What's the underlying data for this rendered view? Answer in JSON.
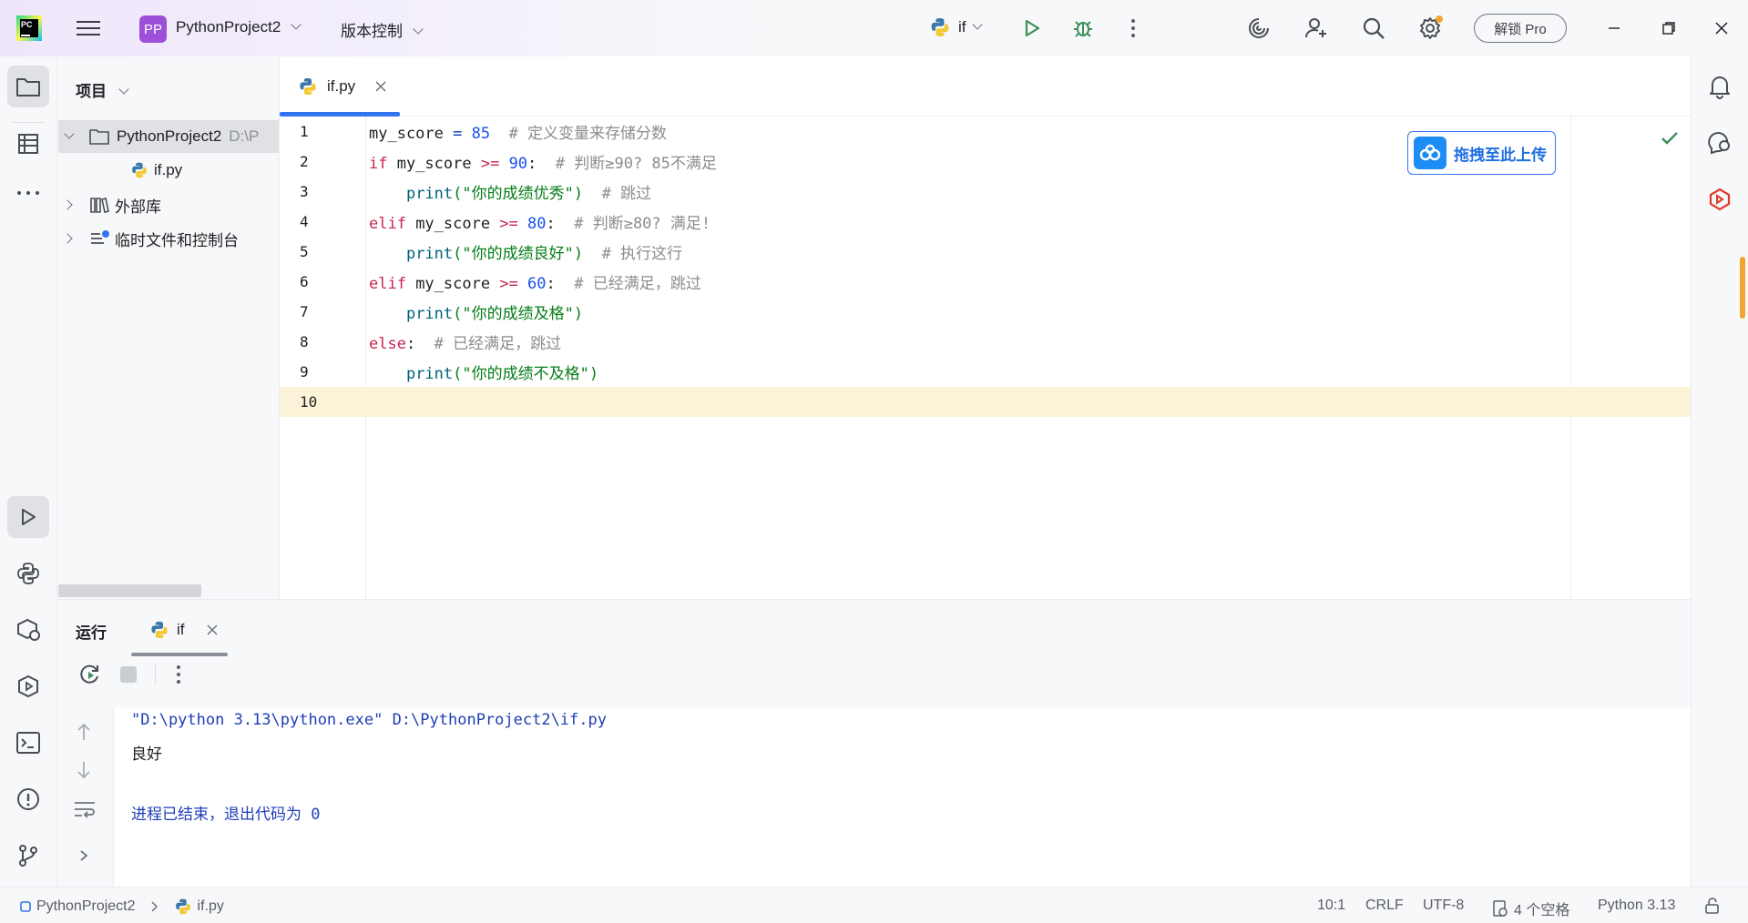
{
  "titlebar": {
    "project_badge": "PP",
    "project_name": "PythonProject2",
    "vcs_label": "版本控制",
    "run_config": "if",
    "pro_button": "解锁 Pro"
  },
  "project_panel": {
    "title": "项目",
    "tree": [
      {
        "label": "PythonProject2",
        "suffix": "D:\\P",
        "type": "folder",
        "expanded": true
      },
      {
        "label": "if.py",
        "type": "python-file"
      },
      {
        "label": "外部库",
        "type": "library"
      },
      {
        "label": "临时文件和控制台",
        "type": "scratches"
      }
    ]
  },
  "editor": {
    "tab_label": "if.py",
    "line_numbers": [
      "1",
      "2",
      "3",
      "4",
      "5",
      "6",
      "7",
      "8",
      "9",
      "10"
    ],
    "code": {
      "l1": [
        "my_score",
        " = ",
        "85",
        "  # 定义变量来存储分数"
      ],
      "l2": [
        "if",
        " my_score ",
        ">=",
        " 90",
        ":",
        "  # 判断≥90? 85不满足"
      ],
      "l3": [
        "    ",
        "print",
        "(\"你的成绩优秀\")",
        "  # 跳过"
      ],
      "l4": [
        "elif",
        " my_score ",
        ">=",
        " 80",
        ":",
        "  # 判断≥80? 满足!"
      ],
      "l5": [
        "    ",
        "print",
        "(\"你的成绩良好\")",
        "  # 执行这行"
      ],
      "l6": [
        "elif",
        " my_score ",
        ">=",
        " 60",
        ":",
        "  # 已经满足，跳过"
      ],
      "l7": [
        "    ",
        "print",
        "(\"你的成绩及格\")"
      ],
      "l8": [
        "else",
        ":",
        "  # 已经满足，跳过"
      ],
      "l9": [
        "    ",
        "print",
        "(\"你的成绩不及格\")"
      ]
    },
    "upload_button": "拖拽至此上传"
  },
  "run_panel": {
    "title": "运行",
    "tab_label": "if",
    "console": [
      "\"D:\\python 3.13\\python.exe\" D:\\PythonProject2\\if.py",
      "良好",
      "",
      "进程已结束，退出代码为 0"
    ]
  },
  "statusbar": {
    "breadcrumb_project": "PythonProject2",
    "breadcrumb_file": "if.py",
    "cursor": "10:1",
    "line_ending": "CRLF",
    "encoding": "UTF-8",
    "indent": "4 个空格",
    "interpreter": "Python 3.13"
  },
  "icons": [
    "pycharm-logo",
    "hamburger-icon",
    "chevron-down-icon",
    "python-icon",
    "run-icon",
    "debug-icon",
    "more-icon",
    "ai-spiral-icon",
    "add-user-icon",
    "search-icon",
    "settings-icon",
    "minimize-icon",
    "restore-icon",
    "close-icon",
    "folder-icon",
    "structure-icon",
    "play-icon",
    "python-console-icon",
    "services-icon",
    "terminal-icon",
    "problems-icon",
    "git-icon",
    "bell-icon",
    "ai-chat-icon",
    "plugin-icon",
    "check-icon",
    "rerun-icon",
    "stop-icon",
    "up-arrow-icon",
    "down-arrow-icon",
    "soft-wrap-icon",
    "upload-cloud-icon"
  ],
  "colors": {
    "accent": "#3574f0",
    "project_badge": "#9c4fd8",
    "run_green": "#3d8f58",
    "current_line": "#fbf3d8",
    "notification_dot": "#f0a732"
  }
}
